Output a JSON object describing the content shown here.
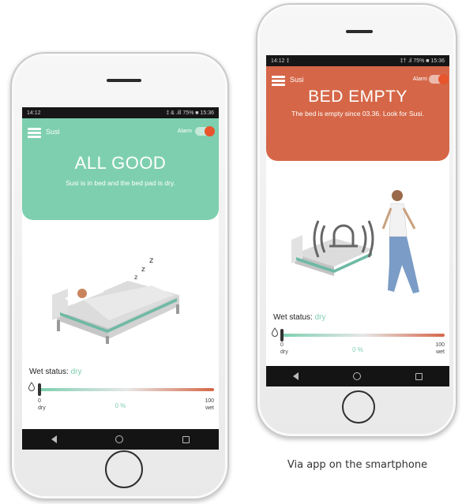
{
  "left_phone": {
    "status": {
      "time": "14:12",
      "right": "‡ & .ill 75% ■ 15:36"
    },
    "header": {
      "user": "Susi",
      "alarm_label": "Alarm"
    },
    "state": {
      "title": "ALL GOOD",
      "message": "Susi is in bed and the bed pad is dry."
    },
    "wet_status": {
      "label": "Wet status:",
      "value": "dry",
      "percent": "0 %",
      "min": "0",
      "min_label": "dry",
      "max": "100",
      "max_label": "wet",
      "level": 0
    }
  },
  "right_phone": {
    "status": {
      "time": "14:12 ‡",
      "right": "‡† .il 75% ■ 15:36"
    },
    "header": {
      "user": "Susi",
      "alarm_label": "Alarm"
    },
    "state": {
      "title": "BED EMPTY",
      "message": "The bed is empty since 03.36. Look for Susi."
    },
    "wet_status": {
      "label": "Wet status:",
      "value": "dry",
      "percent": "0 %",
      "min": "0",
      "min_label": "dry",
      "max": "100",
      "max_label": "wet",
      "level": 0
    }
  },
  "caption": "Via app on the smartphone",
  "colors": {
    "good": "#7ecfb0",
    "alert": "#d56748",
    "toggle_knob": "#e8542b"
  },
  "icons": [
    "menu-icon",
    "drop-icon",
    "bell-icon",
    "back-icon",
    "home-icon",
    "recent-apps-icon"
  ]
}
